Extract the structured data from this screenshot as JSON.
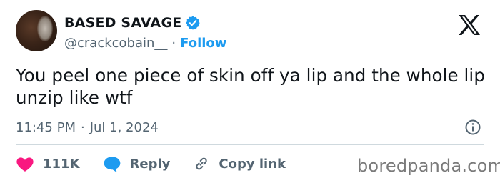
{
  "author": {
    "display_name": "BASED SAVAGE",
    "handle": "@crackcobain__",
    "separator": "·",
    "follow_label": "Follow"
  },
  "tweet": {
    "text": "You peel one piece of skin off ya lip and the whole lip unzip like wtf",
    "time": "11:45 PM",
    "meta_separator": "·",
    "date": "Jul 1, 2024"
  },
  "actions": {
    "likes_count": "111K",
    "reply_label": "Reply",
    "copy_link_label": "Copy link"
  },
  "watermark": "boredpanda.com",
  "icons": {
    "verified": "verified-badge-icon",
    "brand": "x-logo-icon",
    "info": "info-icon",
    "like": "heart-icon",
    "reply": "speech-bubble-icon",
    "copy": "link-icon"
  },
  "colors": {
    "accent": "#1d9bf0",
    "like": "#f91880",
    "secondary_text": "#536471",
    "primary_text": "#0f1419"
  }
}
